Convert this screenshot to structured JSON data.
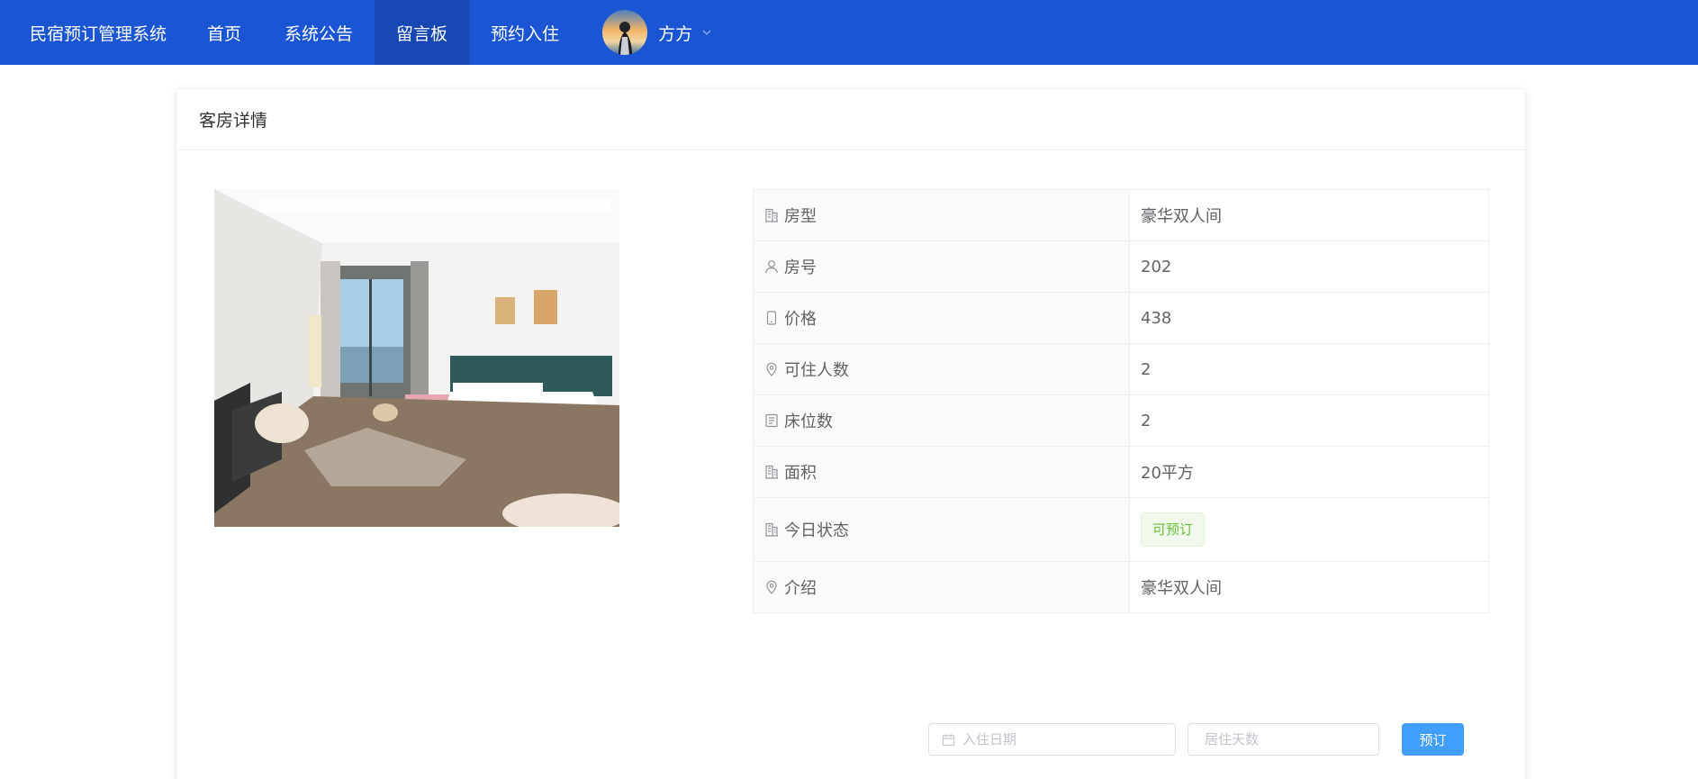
{
  "nav": {
    "brand": "民宿预订管理系统",
    "items": [
      {
        "label": "首页",
        "active": false
      },
      {
        "label": "系统公告",
        "active": false
      },
      {
        "label": "留言板",
        "active": true
      },
      {
        "label": "预约入住",
        "active": false
      }
    ],
    "user": {
      "name": "方方",
      "avatar": "user-avatar-photo",
      "dropdown_icon": "chevron-down-icon"
    },
    "colors": {
      "bar": "#1a56d3",
      "active": "#1747b3"
    }
  },
  "card": {
    "title": "客房详情",
    "photo": "hotel-room-photo"
  },
  "details": {
    "rows": [
      {
        "icon": "office-building-icon",
        "label": "房型",
        "value": "豪华双人间"
      },
      {
        "icon": "user-icon",
        "label": "房号",
        "value": "202"
      },
      {
        "icon": "mobile-phone-icon",
        "label": "价格",
        "value": "438"
      },
      {
        "icon": "location-icon",
        "label": "可住人数",
        "value": "2"
      },
      {
        "icon": "tickets-icon",
        "label": "床位数",
        "value": "2"
      },
      {
        "icon": "office-building-icon",
        "label": "面积",
        "value": "20平方"
      },
      {
        "icon": "office-building-icon",
        "label": "今日状态",
        "value": "可预订",
        "tag_color": "#67c23a"
      },
      {
        "icon": "location-icon",
        "label": "介绍",
        "value": "豪华双人间"
      }
    ]
  },
  "booking": {
    "date_placeholder": "入住日期",
    "days_placeholder": "居住天数",
    "submit_label": "预订",
    "accent": "#409eff"
  }
}
